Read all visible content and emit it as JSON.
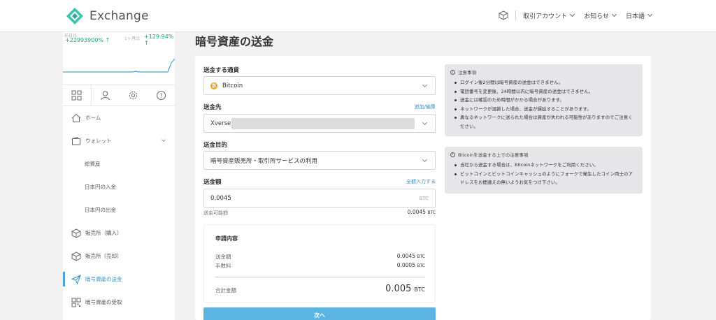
{
  "header": {
    "brand": "Exchange",
    "trade_account": "取引アカウント",
    "notifications": "お知らせ",
    "language": "日本語"
  },
  "sidebar": {
    "ticker": {
      "left_label": "前日比",
      "left_value": "+22993900% ↑",
      "right_label": "1ヶ月比",
      "right_value": "+129.94% ↑"
    },
    "items": [
      {
        "label": "ホーム",
        "icon": "home-icon"
      },
      {
        "label": "ウォレット",
        "icon": "wallet-icon"
      },
      {
        "label": "総資産"
      },
      {
        "label": "日本円の入金"
      },
      {
        "label": "日本円の出金"
      },
      {
        "label": "販売所（購入）",
        "icon": "cube-icon"
      },
      {
        "label": "販売所（売却）",
        "icon": "cube-icon"
      },
      {
        "label": "暗号資産の送金",
        "icon": "send-icon",
        "active": true
      },
      {
        "label": "暗号資産の受取",
        "icon": "qr-code-icon"
      }
    ]
  },
  "page_title": "暗号資産の送金",
  "form": {
    "currency_label": "送金する通貨",
    "currency_value": "Bitcoin",
    "destination_label": "送金先",
    "destination_link": "追加/編集",
    "destination_value": "Xverse",
    "purpose_label": "送金目的",
    "purpose_value": "暗号資産販売所・取引所サービスの利用",
    "amount_label": "送金額",
    "amount_link": "全額入力する",
    "amount_value": "0.0045",
    "amount_unit": "BTC",
    "available_label": "送金可能額",
    "available_value": "0.0045",
    "available_unit": "BTC"
  },
  "summary": {
    "title": "申請内容",
    "amount_label": "送金額",
    "amount_value": "0.0045",
    "fee_label": "手数料",
    "fee_value": "0.0005",
    "total_label": "合計金額",
    "total_value": "0.005",
    "unit": "BTC"
  },
  "next_button": "次へ",
  "notes": {
    "general_title": "注意事項",
    "general_items": [
      "ログイン後2分間は暗号資産の送金はできません。",
      "電話番号を変更後、24時間以内に暗号資産の送金はできません。",
      "送金には確認のため時間がかかる場合があります。",
      "ネットワークが混雑した場合、送金が遅延することがあります。",
      "異なるネットワークに送られた場合は資産が失われる可能性がありますのでご注意ください。"
    ],
    "btc_title": "Bitcoinを送金する上での注意事項",
    "btc_items": [
      "当社から送金する場合は、Bitcoinネットワークをご利用ください。",
      "ビットコインとビットコインキャッシュのようにフォークで発生したコイン両士のアドレスをお間違えの無いようお気をつけ下さい。"
    ]
  }
}
